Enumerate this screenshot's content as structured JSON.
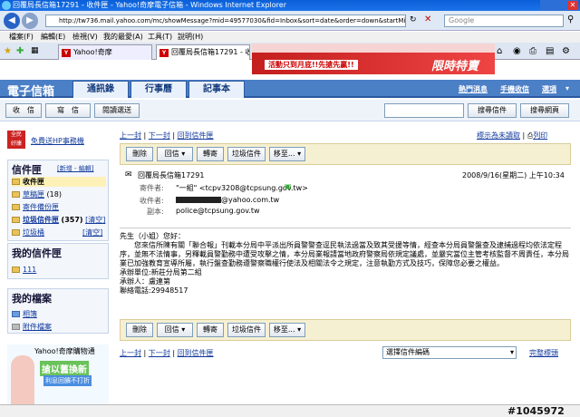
{
  "window": {
    "title": "回覆局長信箱17291 - 收件匣 - Yahoo!奇摩電子信箱 - Windows Internet Explorer"
  },
  "browser": {
    "url": "http://tw736.mail.yahoo.com/mc/showMessage?mid=49577030&fid=Inbox&sort=date&order=down&startMid=1_305784_AGj/vMskAGwKSM8a7AKwKWcIkDoE",
    "search_placeholder": "Google",
    "menu": [
      "檔案(F)",
      "編輯(E)",
      "檢視(V)",
      "我的最愛(A)",
      "工具(T)",
      "說明(H)"
    ],
    "tabs": [
      {
        "label": "Yahoo!奇摩"
      },
      {
        "label": "回覆局長信箱17291 - 收..."
      }
    ],
    "banner_text": "活動只到月底!!先搶先贏!!",
    "banner_badge": "限時特賣"
  },
  "app": {
    "brand": "電子信箱",
    "nav_tabs": [
      "通訊錄",
      "行事曆",
      "記事本"
    ],
    "top_links": [
      "熱門消息",
      "手機收信",
      "選項"
    ],
    "toolbar": {
      "receive": "收　信",
      "compose": "寫　信",
      "rss": "閱讀選送",
      "search_mail": "搜尋信件",
      "search_web": "搜尋網頁"
    }
  },
  "sidebar": {
    "promo": "免費送HP事務機",
    "folders_title": "信件匣",
    "folders_actions": "[新增 - 編輯]",
    "folders": [
      {
        "name": "收件匣",
        "count": ""
      },
      {
        "name": "草稿匣",
        "count": "(18)"
      },
      {
        "name": "寄件備份匣",
        "count": ""
      },
      {
        "name": "垃圾信件匣",
        "count": "(357)"
      },
      {
        "name": "垃圾桶",
        "count": ""
      }
    ],
    "clear_label": "[清空]",
    "my_folders_title": "我的信件匣",
    "my_folders": [
      "111"
    ],
    "my_files_title": "我的檔案",
    "my_files": [
      "相簿",
      "附件檔案"
    ],
    "ad_title": "Yahoo!奇摩購物通",
    "ad_text": "搶以舊換新",
    "ad_sub": "利息回饋不打折"
  },
  "message": {
    "nav": {
      "prev": "上一封",
      "next": "下一封",
      "back": "回到信件匣",
      "mark_unread": "標示為未讀取",
      "print": "列印"
    },
    "actions": {
      "delete": "刪除",
      "reply": "回信",
      "forward": "轉寄",
      "spam": "垃圾信件",
      "move": "移至..."
    },
    "subject": "回覆局長信箱17291",
    "date": "2008/9/16(星期二) 上午10:34",
    "from_label": "寄件者:",
    "from": "\"一組\" <tcpv3208@tcpsung.gov.tw>",
    "to_label": "收件者:",
    "to": "@yahoo.com.tw",
    "cc_label": "副本:",
    "cc": "police@tcpsung.gov.tw",
    "greeting": "先生（小姐）您好：",
    "body": "您來信所陳有關「聯合報」刊載本分局中平派出所員警警查逕民執法過當及致其受援等情，經查本分局員警盤查及逮捕過程均依法定程序，並無不法情事，另釋載員警勤務中遭受攻擊之情，本分局業報請當地政府警察局依規定議處，並嚴究當位主管考核監督不周責任，本分局業已加強教育宣導所屬，執行盤查勤務遵警察職權行使法及相關法令之規定，注意執勤方式及技巧，保障您必要之權益。",
    "unit_label": "承辦單位:",
    "unit": "新莊分局第二組",
    "person_label": "承辦人：",
    "person": "盧連第",
    "phone_label": "聯絡電話:",
    "phone": "29948517",
    "encoding_select": "選擇信件編碼",
    "full_header": "完整標頭"
  },
  "watermark": "#1045972"
}
